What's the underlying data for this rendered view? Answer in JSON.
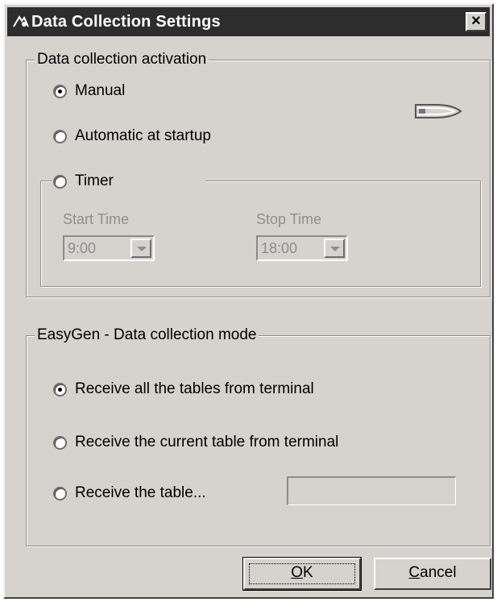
{
  "window": {
    "title": "Data Collection Settings",
    "close_label": "×"
  },
  "activation": {
    "legend": "Data collection activation",
    "options": [
      {
        "label": "Manual",
        "checked": true
      },
      {
        "label": "Automatic at startup",
        "checked": false
      },
      {
        "label": "Timer",
        "checked": false
      }
    ],
    "start_time_label": "Start Time",
    "start_time_value": "9:00",
    "stop_time_label": "Stop Time",
    "stop_time_value": "18:00",
    "icon": "plug-icon"
  },
  "mode": {
    "legend": "EasyGen - Data collection mode",
    "options": [
      {
        "label": "Receive all the tables from terminal",
        "checked": true
      },
      {
        "label": "Receive the current table from terminal",
        "checked": false
      },
      {
        "label": "Receive the table...",
        "checked": false
      }
    ],
    "table_name_value": ""
  },
  "buttons": {
    "ok": "OK",
    "cancel": "Cancel"
  },
  "colors": {
    "face": "#d6d3ce",
    "titlebar": "#2d2d2d",
    "disabled_text": "#8e8e8e"
  }
}
